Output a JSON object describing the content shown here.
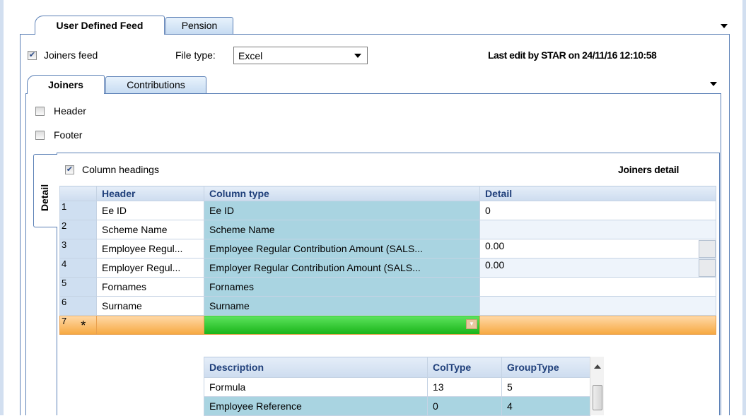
{
  "tabs": [
    {
      "label": "User Defined Feed",
      "active": true
    },
    {
      "label": "Pension",
      "active": false
    }
  ],
  "joiners_feed": {
    "label": "Joiners feed",
    "checked": true
  },
  "file_type": {
    "label": "File type:",
    "value": "Excel"
  },
  "last_edit": "Last edit by STAR on 24/11/16 12:10:58",
  "subtabs": [
    {
      "label": "Joiners",
      "active": true
    },
    {
      "label": "Contributions",
      "active": false
    }
  ],
  "header_option": {
    "label": "Header",
    "checked": false
  },
  "footer_option": {
    "label": "Footer",
    "checked": false
  },
  "detail_tab": "Detail",
  "column_headings": {
    "label": "Column headings",
    "checked": true
  },
  "section_title": "Joiners detail",
  "grid": {
    "columns": [
      "Header",
      "Column type",
      "Detail"
    ],
    "rows": [
      {
        "num": "1",
        "header": "Ee ID",
        "column_type": "Ee ID",
        "detail": "0"
      },
      {
        "num": "2",
        "header": "Scheme Name",
        "column_type": "Scheme Name",
        "detail": ""
      },
      {
        "num": "3",
        "header": "Employee Regul...",
        "column_type": "Employee Regular Contribution Amount (SALS...",
        "detail": "0.00"
      },
      {
        "num": "4",
        "header": "Employer Regul...",
        "column_type": "Employer Regular Contribution Amount (SALS...",
        "detail": "0.00"
      },
      {
        "num": "5",
        "header": "Fornames",
        "column_type": "Fornames",
        "detail": ""
      },
      {
        "num": "6",
        "header": "Surname",
        "column_type": "Surname",
        "detail": ""
      }
    ],
    "new_row": {
      "num": "7",
      "marker": "*"
    }
  },
  "dropdown_list": {
    "columns": [
      "Description",
      "ColType",
      "GroupType"
    ],
    "rows": [
      {
        "description": "Formula",
        "coltype": "13",
        "grouptype": "5"
      },
      {
        "description": "Employee Reference",
        "coltype": "0",
        "grouptype": "4"
      }
    ]
  },
  "colors": {
    "border": "#5b80b6",
    "selection": "#a9d4e1",
    "new_row": "#f6a840",
    "editor": "#18b318"
  }
}
